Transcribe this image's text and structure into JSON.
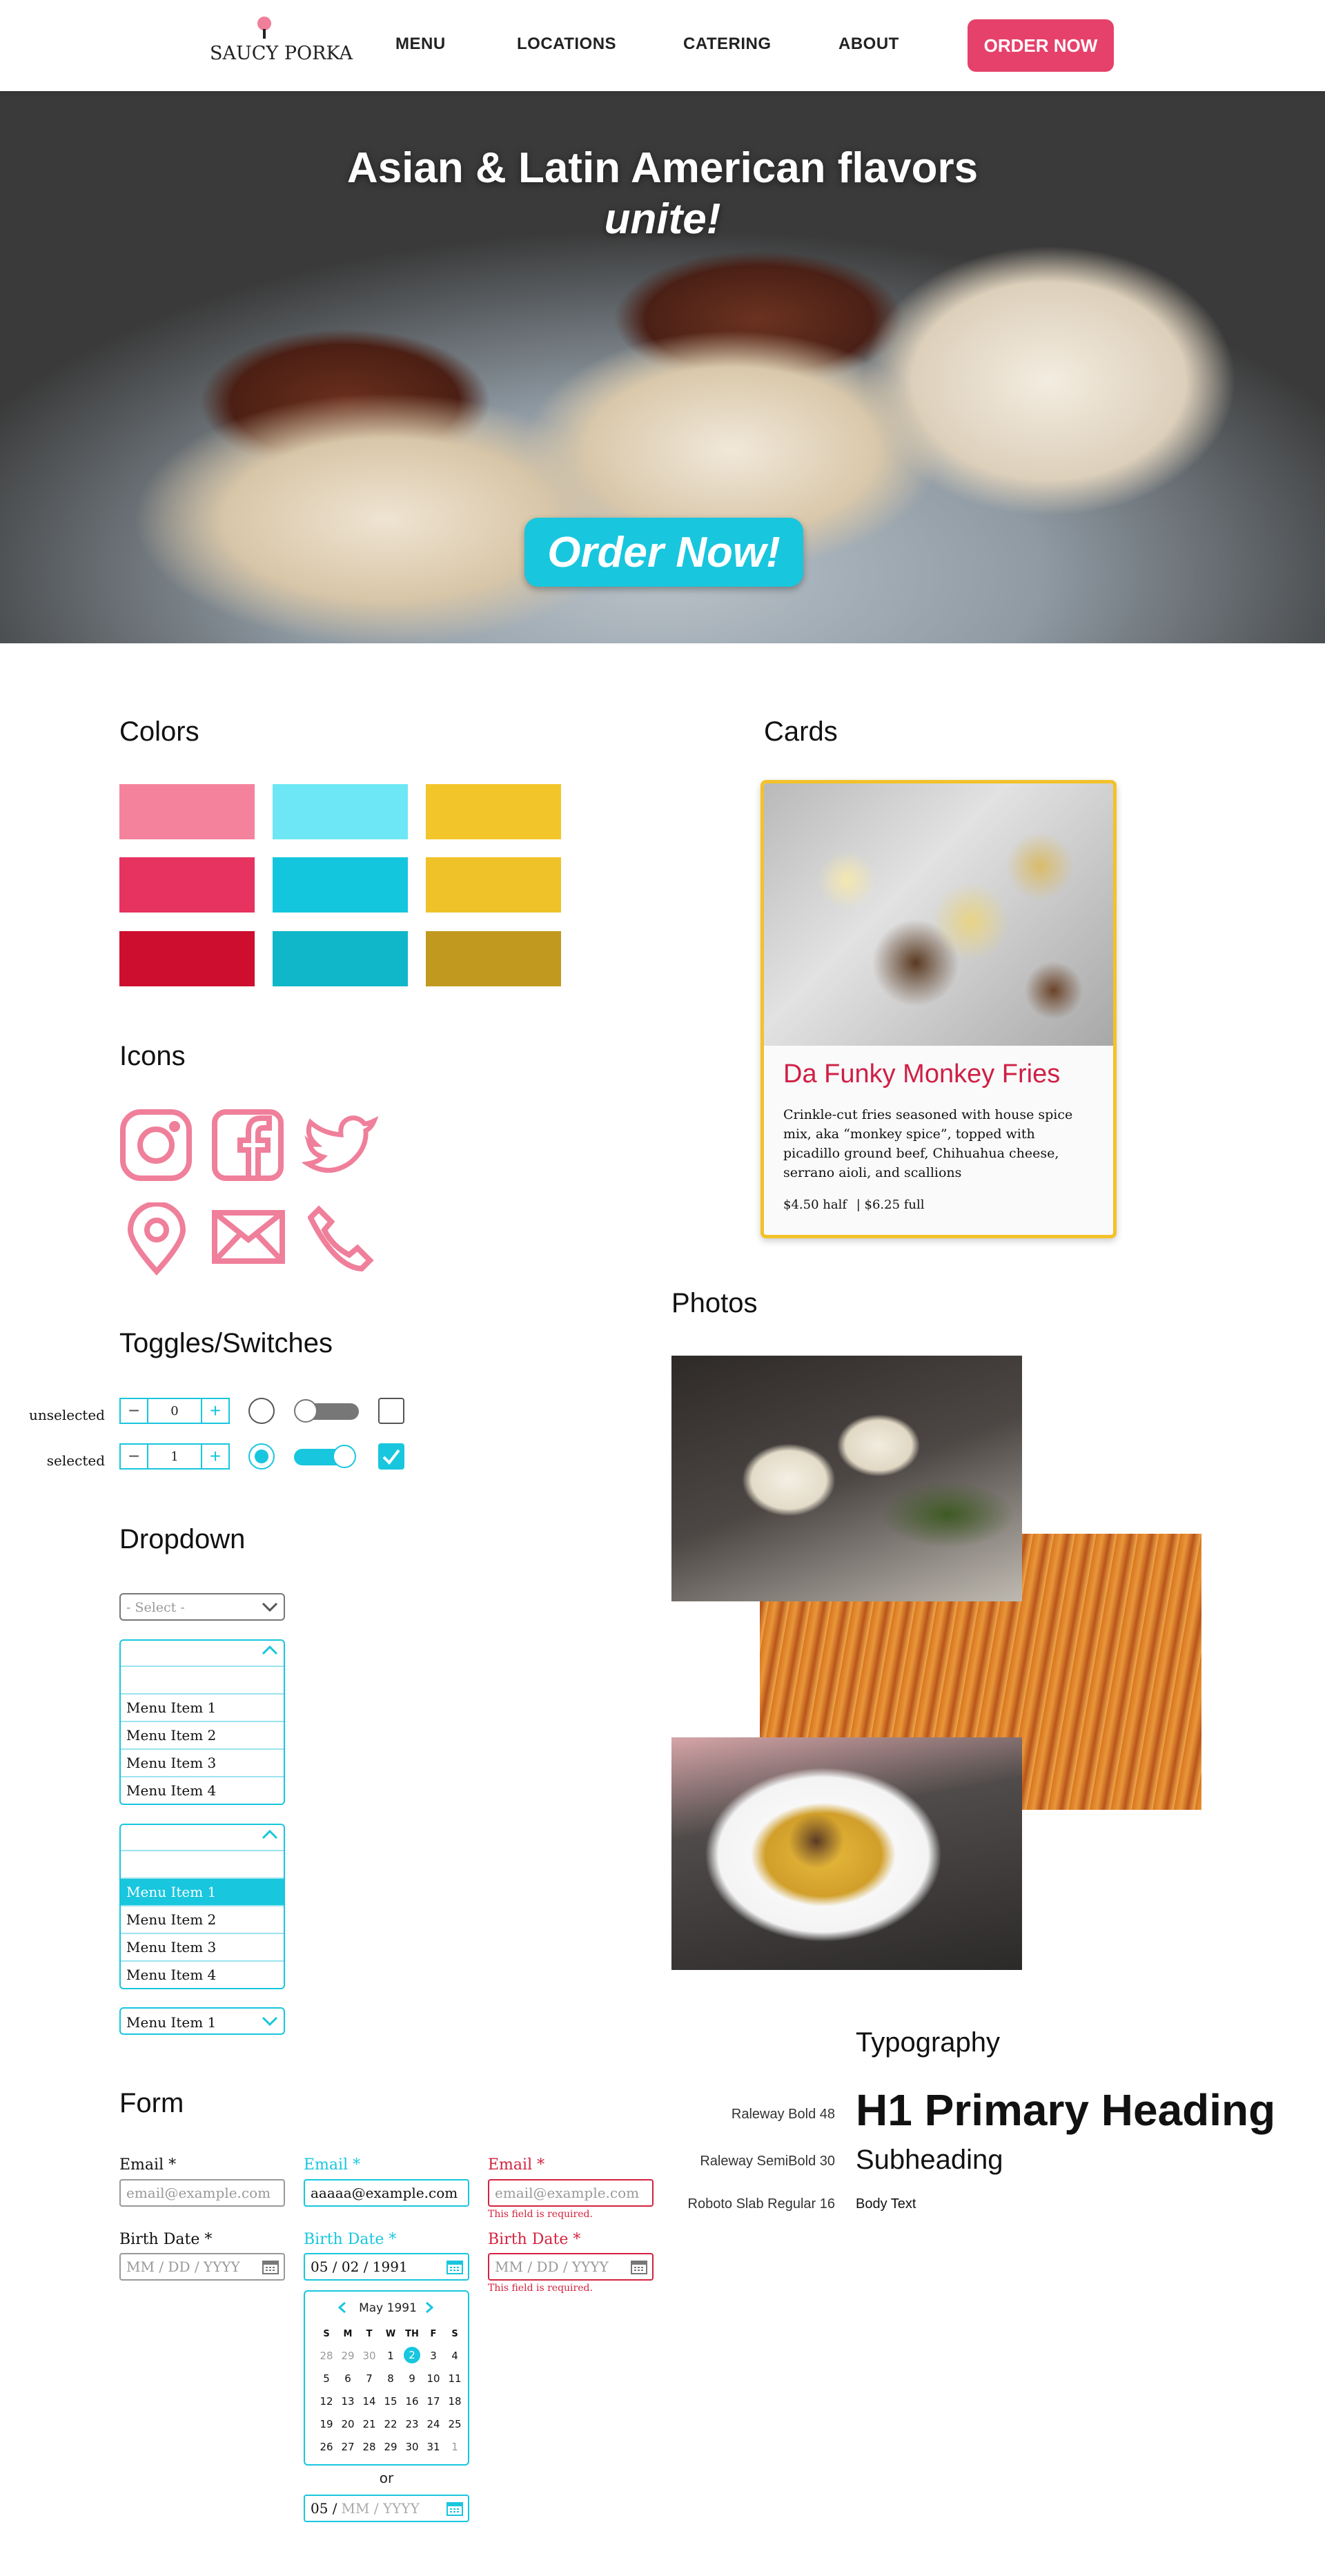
{
  "nav": {
    "logo": "SAUCY PORKA",
    "links": [
      "MENU",
      "LOCATIONS",
      "CATERING",
      "ABOUT"
    ],
    "order_button": "ORDER NOW"
  },
  "hero": {
    "title_line1": "Asian & Latin American flavors",
    "title_line2": "unite!",
    "button": "Order Now!"
  },
  "colors": {
    "heading": "Colors",
    "swatches": [
      [
        "#f5829c",
        "#6de7f5",
        "#f2c52a"
      ],
      [
        "#e6335f",
        "#13c6de",
        "#efc22a"
      ],
      [
        "#cd0e2f",
        "#0fb7c9",
        "#c1991f"
      ]
    ]
  },
  "icons": {
    "heading": "Icons",
    "items": [
      "instagram-icon",
      "facebook-icon",
      "twitter-icon",
      "location-pin-icon",
      "mail-icon",
      "phone-icon"
    ]
  },
  "toggles": {
    "heading": "Toggles/Switches",
    "unselected_label": "unselected",
    "selected_label": "selected",
    "unselected_value": "0",
    "selected_value": "1"
  },
  "dropdown": {
    "heading": "Dropdown",
    "placeholder": "- Select -",
    "items": [
      "Menu Item 1",
      "Menu Item 2",
      "Menu Item 3",
      "Menu Item 4"
    ],
    "selected_value": "Menu Item 1"
  },
  "form": {
    "heading": "Form",
    "email_label": "Email *",
    "email_placeholder": "email@example.com",
    "email_value": "aaaaa@example.com",
    "birth_label": "Birth Date *",
    "birth_placeholder": "MM / DD / YYYY",
    "birth_value": "05 / 02 / 1991",
    "error": "This field is required.",
    "or": "or",
    "partial_day": "05 /",
    "partial_rest": "MM / YYYY",
    "calendar": {
      "month": "May 1991",
      "weekdays": [
        "S",
        "M",
        "T",
        "W",
        "TH",
        "F",
        "S"
      ],
      "rows": [
        [
          "28",
          "29",
          "30",
          "1",
          "2",
          "3",
          "4"
        ],
        [
          "5",
          "6",
          "7",
          "8",
          "9",
          "10",
          "11"
        ],
        [
          "12",
          "13",
          "14",
          "15",
          "16",
          "17",
          "18"
        ],
        [
          "19",
          "20",
          "21",
          "22",
          "23",
          "24",
          "25"
        ],
        [
          "26",
          "27",
          "28",
          "29",
          "30",
          "31",
          "1"
        ]
      ],
      "selected": "2"
    }
  },
  "cards": {
    "heading": "Cards",
    "title": "Da Funky Monkey Fries",
    "desc_lines": [
      "Crinkle-cut fries seasoned with house spice",
      "mix, aka “monkey spice”, topped with",
      "picadillo ground beef, Chihuahua cheese,",
      "serrano aioli, and scallions"
    ],
    "price_half": "$4.50 half",
    "price_full": "| $6.25 full"
  },
  "photos": {
    "heading": "Photos"
  },
  "typography": {
    "heading": "Typography",
    "rows": [
      {
        "spec": "Raleway Bold 48",
        "sample": "H1 Primary Heading"
      },
      {
        "spec": "Raleway SemiBold 30",
        "sample": "Subheading"
      },
      {
        "spec": "Roboto Slab Regular 16",
        "sample": "Body Text"
      }
    ]
  },
  "accent": {
    "pink": "#e6416b",
    "cyan": "#18c6de",
    "gold": "#f3c12a",
    "card_title": "#d01f45"
  }
}
